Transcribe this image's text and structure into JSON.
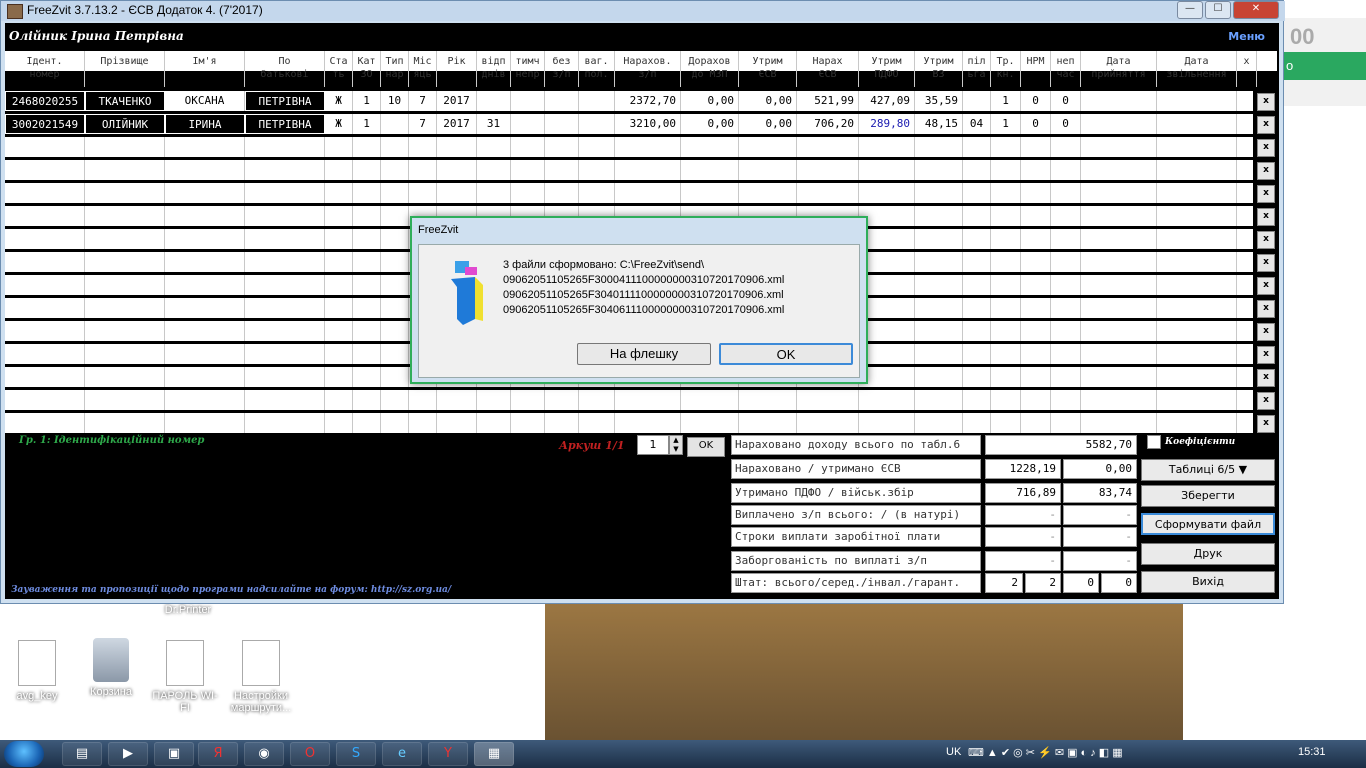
{
  "window": {
    "title": "FreeZvit 3.7.13.2 - ЄСВ Додаток 4. (7'2017)",
    "btn_min": "—",
    "btn_max": "☐",
    "btn_close": "✕",
    "path_text": "Олійник Ірина Петрівна",
    "menu_label": "Меню"
  },
  "table": {
    "headers": [
      "Ідент.\nномер",
      "Прізвище",
      "Ім'я",
      "По\nбатькові",
      "Ста\nть",
      "Кат\nЗО",
      "Тип\nнар",
      "Міс\nяць",
      "Рік",
      "відп\nднів",
      "тимч\nнепр",
      "без\nз/п",
      "ваг.\nпол.",
      "Нарахов.\nз/п",
      "Дорахов\nдо МЗП",
      "Утрим\nЄСВ",
      "Нарах\nЄСВ",
      "Утрим\nПДФО",
      "Утрим\nВЗ",
      "піл\nьга",
      "Тр.\nкн.",
      "НРМ",
      "неп\nчас",
      "Дата\nприйняття",
      "Дата\nзвільнення",
      "x"
    ],
    "rows": [
      [
        "2468020255",
        "ТКАЧЕНКО",
        "ОКСАНА",
        "ПЕТРІВНА",
        "Ж",
        "1",
        "10",
        "7",
        "2017",
        "",
        "",
        "",
        "",
        "2372,70",
        "0,00",
        "0,00",
        "521,99",
        "427,09",
        "35,59",
        "",
        "1",
        "0",
        "0",
        "",
        ""
      ],
      [
        "3002021549",
        "ОЛІЙНИК",
        "ІРИНА",
        "ПЕТРІВНА",
        "Ж",
        "1",
        "",
        "7",
        "2017",
        "31",
        "",
        "",
        "",
        "3210,00",
        "0,00",
        "0,00",
        "706,20",
        "289,80",
        "48,15",
        "04",
        "1",
        "0",
        "0",
        "",
        ""
      ]
    ],
    "empty_rows": 13,
    "delete_label": "x"
  },
  "status": {
    "hint": "Гр. 1: Ідентифікаційний номер",
    "footer": "Зауваження та пропозиції щодо програми надсилайте на форум: http://sz.org.ua/",
    "pager_label": "Аркуш 1/1",
    "pager_value": "1",
    "pager_ok": "OK"
  },
  "summary": {
    "rows": [
      {
        "label": "Нараховано доходу всього по табл.6",
        "v1": "5582,70",
        "v2": null
      },
      {
        "label": "Нараховано / утримано ЄСВ",
        "v1": "1228,19",
        "v2": "0,00"
      },
      {
        "label": "Утримано ПДФО / військ.збір",
        "v1": "716,89",
        "v2": "83,74"
      },
      {
        "label": "Виплачено з/п всього: / (в натурі)",
        "v1": "-",
        "v2": "-"
      },
      {
        "label": "Строки виплати заробітної плати",
        "v1": "-",
        "v2": "-"
      },
      {
        "label": "Заборгованість по виплаті з/п",
        "v1": "-",
        "v2": "-"
      },
      {
        "label": "Штат: всього/серед./інвал./гарант.",
        "v1": "2",
        "v2": "2",
        "v3": "0",
        "v4": "0"
      }
    ]
  },
  "right_panel": {
    "coef_label": "Коефіцієнти",
    "tables_dropdown": "Таблиці 6/5",
    "save": "Зберегти",
    "generate": "Сформувати файл",
    "print": "Друк",
    "exit": "Вихід"
  },
  "dialog": {
    "title": "FreeZvit",
    "line1": "3 файли сформовано: C:\\FreeZvit\\send\\",
    "line2": "09062051105265F3000411100000000310720170906.xml",
    "line3": "09062051105265F3040111100000000310720170906.xml",
    "line4": "09062051105265F3040611100000000310720170906.xml",
    "btn_flash": "На флешку",
    "btn_ok": "OK"
  },
  "desktop": {
    "top_label": "Dr.Printer",
    "icons": [
      "avg_key",
      "Корзина",
      "ПАРОЛЬ WI-FI",
      "Настройки маршрути..."
    ]
  },
  "side": {
    "text1": "00",
    "text2": "о"
  },
  "taskbar": {
    "lang": "UK",
    "time": "15:31"
  }
}
